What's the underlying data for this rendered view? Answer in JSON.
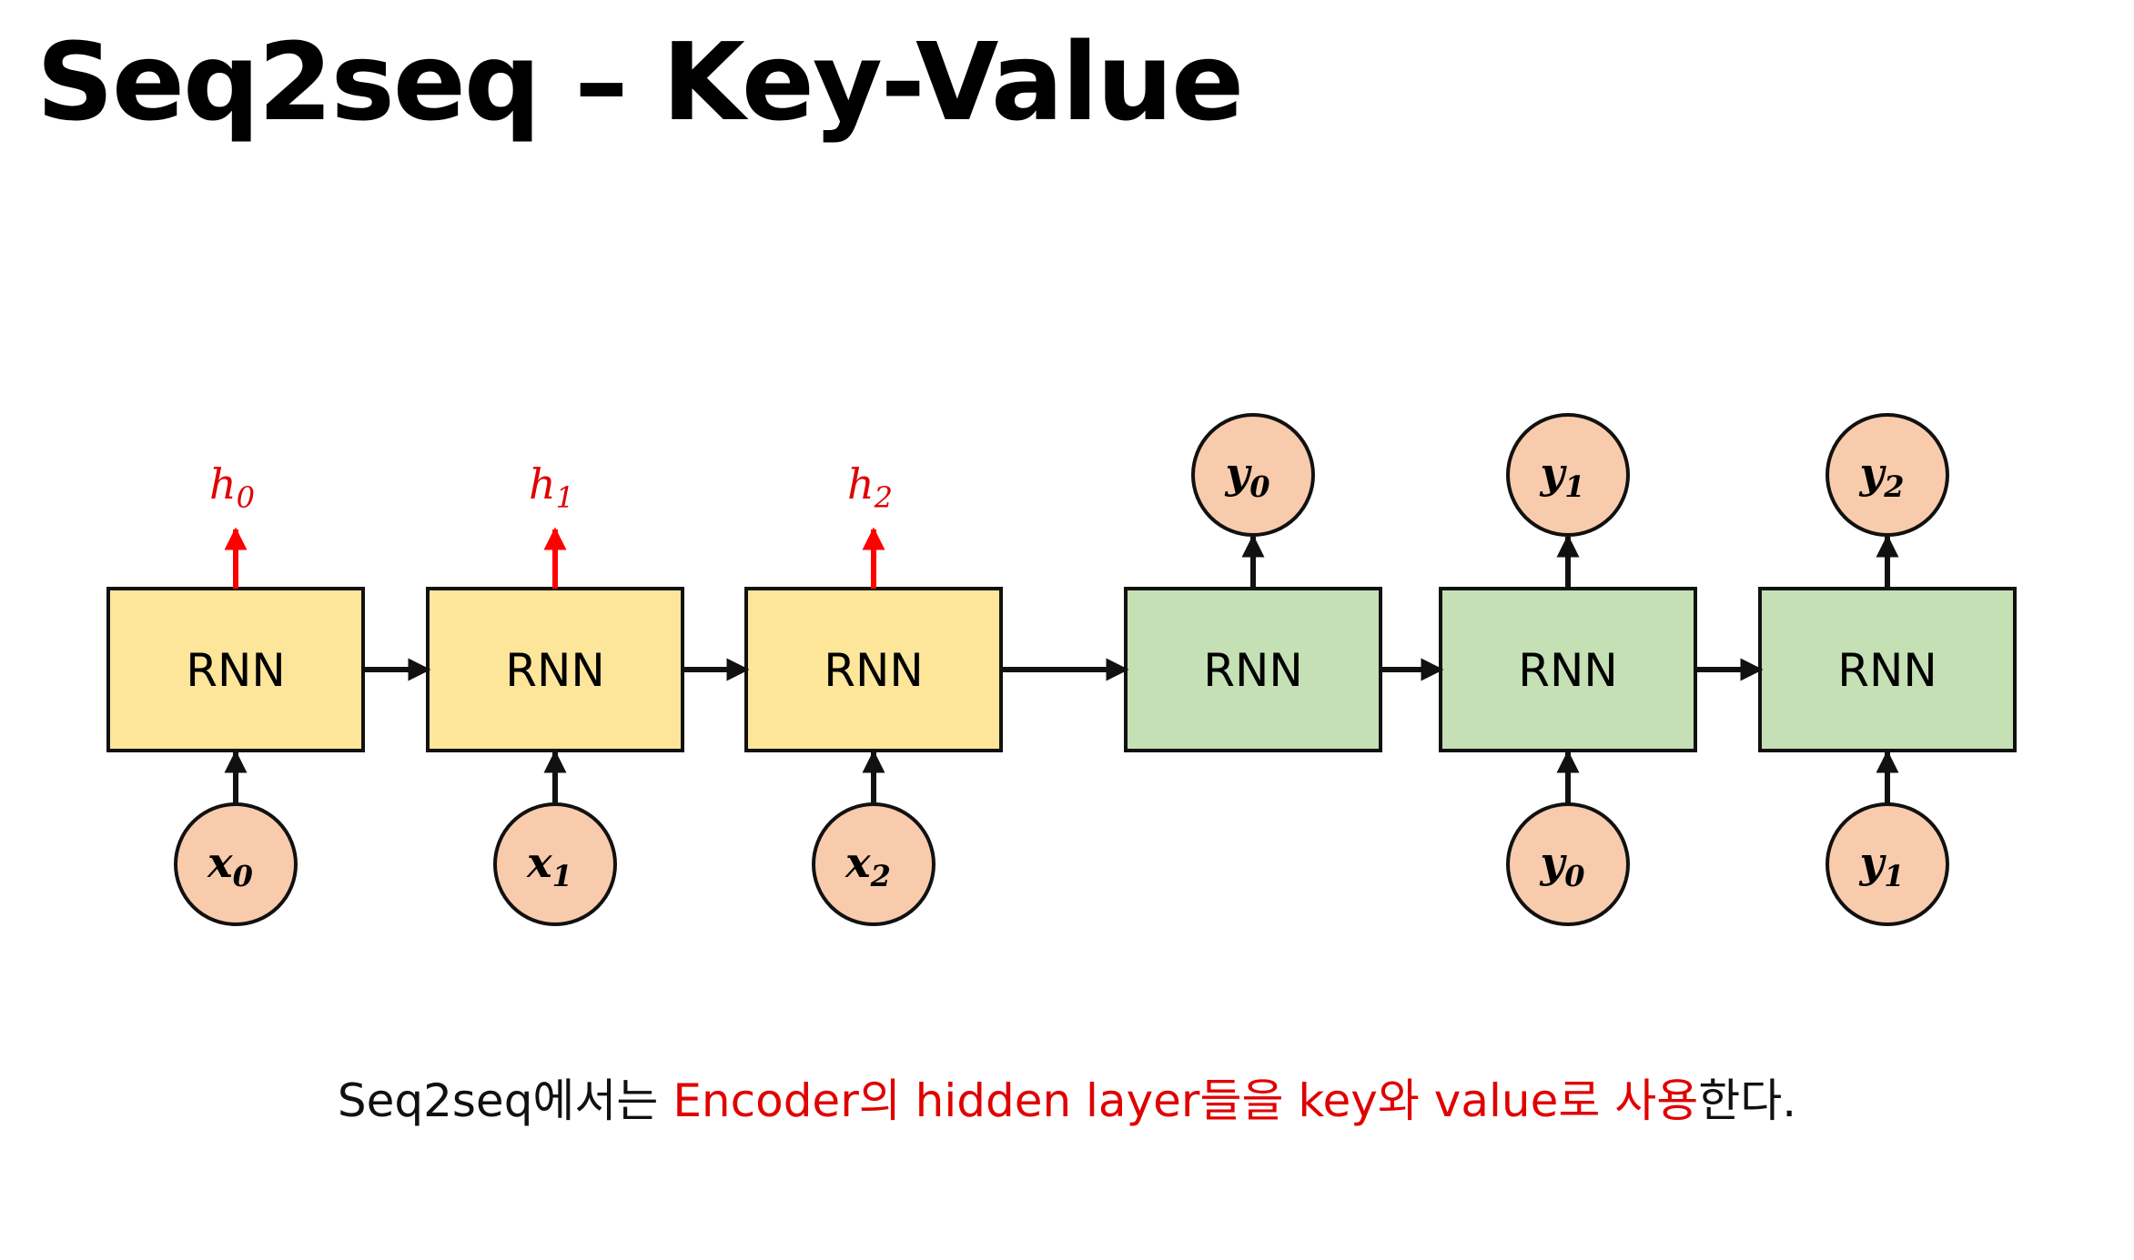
{
  "title": "Seq2seq – Key-Value",
  "colors": {
    "encoder_fill": "#fde599",
    "decoder_fill": "#c5e0b4",
    "node_fill": "#f8cbad",
    "stroke": "#111111",
    "hidden_arrow": "#ff0000",
    "highlight_text": "#e00000"
  },
  "encoder": {
    "cells": [
      {
        "label": "RNN",
        "input": {
          "var": "x",
          "sub": "0"
        },
        "hidden": {
          "var": "h",
          "sub": "0"
        }
      },
      {
        "label": "RNN",
        "input": {
          "var": "x",
          "sub": "1"
        },
        "hidden": {
          "var": "h",
          "sub": "1"
        }
      },
      {
        "label": "RNN",
        "input": {
          "var": "x",
          "sub": "2"
        },
        "hidden": {
          "var": "h",
          "sub": "2"
        }
      }
    ]
  },
  "decoder": {
    "cells": [
      {
        "label": "RNN",
        "input": null,
        "output": {
          "var": "y",
          "sub": "0"
        }
      },
      {
        "label": "RNN",
        "input": {
          "var": "y",
          "sub": "0"
        },
        "output": {
          "var": "y",
          "sub": "1"
        }
      },
      {
        "label": "RNN",
        "input": {
          "var": "y",
          "sub": "1"
        },
        "output": {
          "var": "y",
          "sub": "2"
        }
      }
    ]
  },
  "caption": {
    "prefix": "Seq2seq에서는 ",
    "highlight": "Encoder의 hidden layer들을 key와 value로 사용",
    "suffix": "한다."
  }
}
